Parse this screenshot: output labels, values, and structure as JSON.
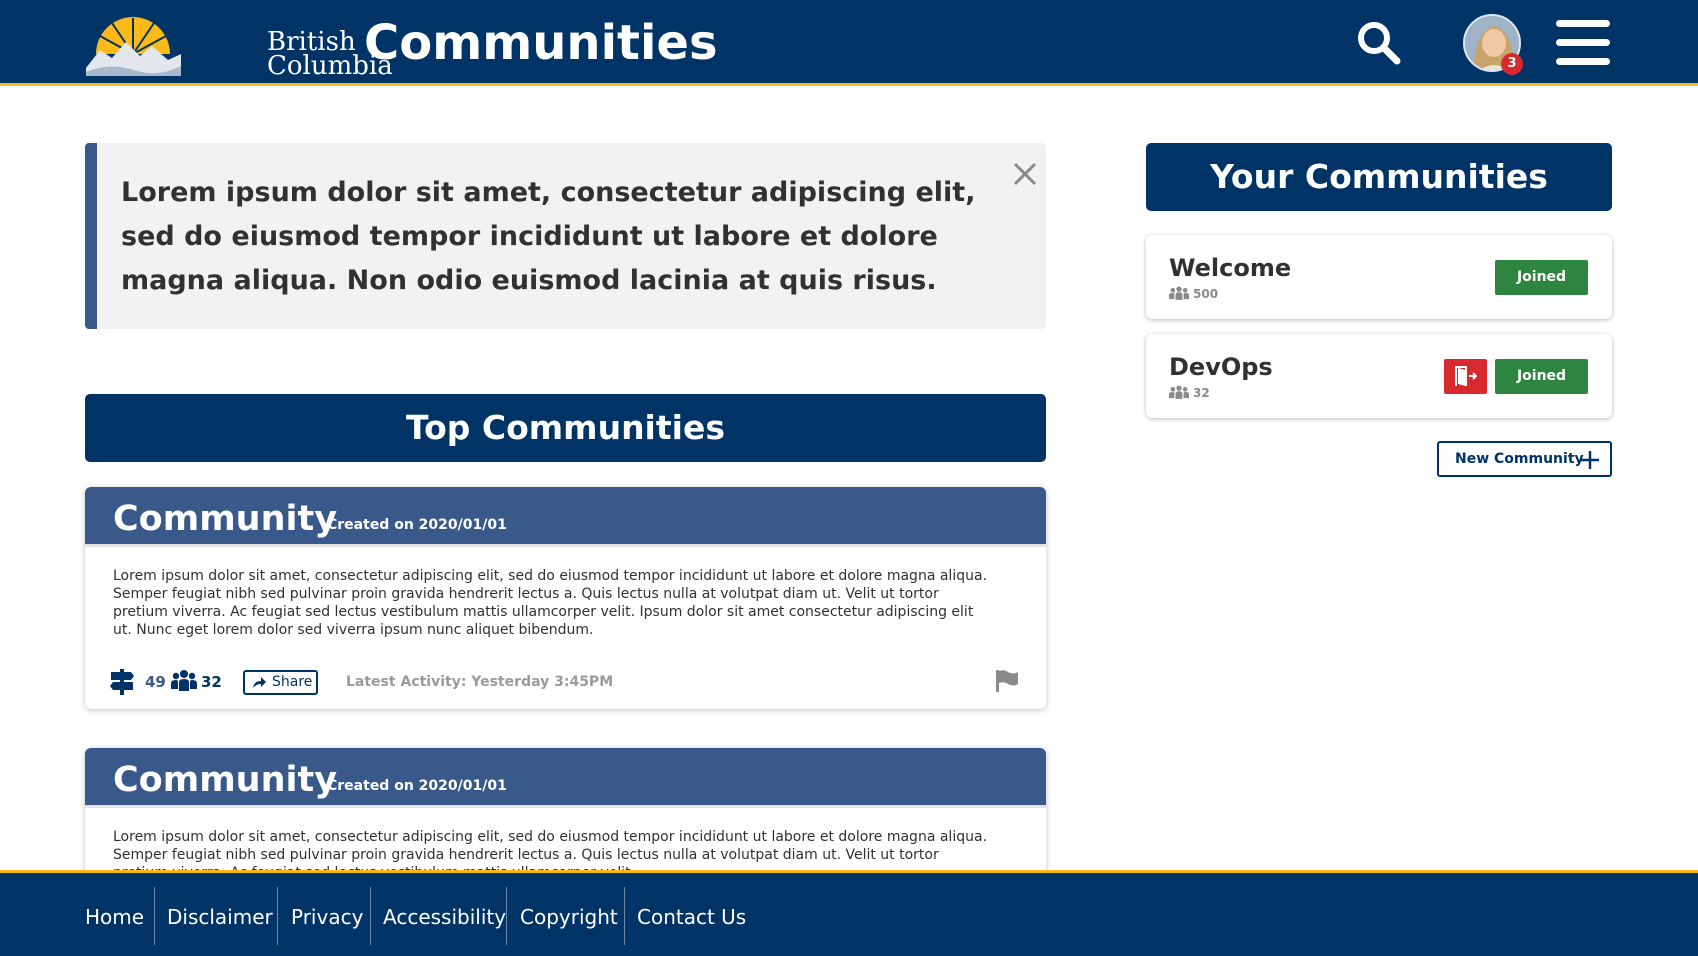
{
  "header": {
    "logo_line1": "British",
    "logo_line2": "Columbia",
    "title": "Communities",
    "notification_count": "3",
    "icons": {
      "search": "search-icon",
      "menu": "hamburger-menu-icon",
      "avatar": "user-avatar"
    }
  },
  "alert": {
    "text": "Lorem ipsum dolor sit amet, consectetur adipiscing elit, sed do eiusmod tempor incididunt ut labore et dolore magna aliqua. Non odio euismod lacinia at quis risus.",
    "close_icon": "close-icon"
  },
  "top_communities": {
    "heading": "Top Communities",
    "cards": [
      {
        "title": "Community",
        "created": "Created on 2020/01/01",
        "body": "Lorem ipsum dolor sit amet, consectetur adipiscing elit, sed do eiusmod tempor incididunt ut labore et dolore magna aliqua. Semper feugiat nibh sed pulvinar proin gravida hendrerit lectus a. Quis lectus nulla at volutpat diam ut. Velit ut tortor pretium viverra. Ac feugiat sed lectus vestibulum mattis ullamcorper velit. Ipsum dolor sit amet consectetur adipiscing elit ut. Nunc eget lorem dolor sed viverra ipsum nunc aliquet bibendum.",
        "topics_count": "49",
        "members_count": "32",
        "share_label": "Share",
        "latest_activity": "Latest Activity: Yesterday 3:45PM"
      },
      {
        "title": "Community",
        "created": "Created on 2020/01/01",
        "body": "Lorem ipsum dolor sit amet, consectetur adipiscing elit, sed do eiusmod tempor incididunt ut labore et dolore magna aliqua. Semper feugiat nibh sed pulvinar proin gravida hendrerit lectus a. Quis lectus nulla at volutpat diam ut. Velit ut tortor pretium viverra. Ac feugiat sed lectus vestibulum mattis ullamcorper velit."
      }
    ]
  },
  "your_communities": {
    "heading": "Your Communities",
    "items": [
      {
        "name": "Welcome",
        "members": "500",
        "status": "Joined"
      },
      {
        "name": "DevOps",
        "members": "32",
        "status": "Joined"
      }
    ],
    "new_button": "New Community"
  },
  "footer": {
    "links": [
      "Home",
      "Disclaimer",
      "Privacy",
      "Accessibility",
      "Copyright",
      "Contact Us"
    ]
  },
  "colors": {
    "primary": "#003366",
    "accent": "#fcba19",
    "card_header": "#38598a",
    "joined": "#2e8540",
    "leave": "#d8292f"
  }
}
